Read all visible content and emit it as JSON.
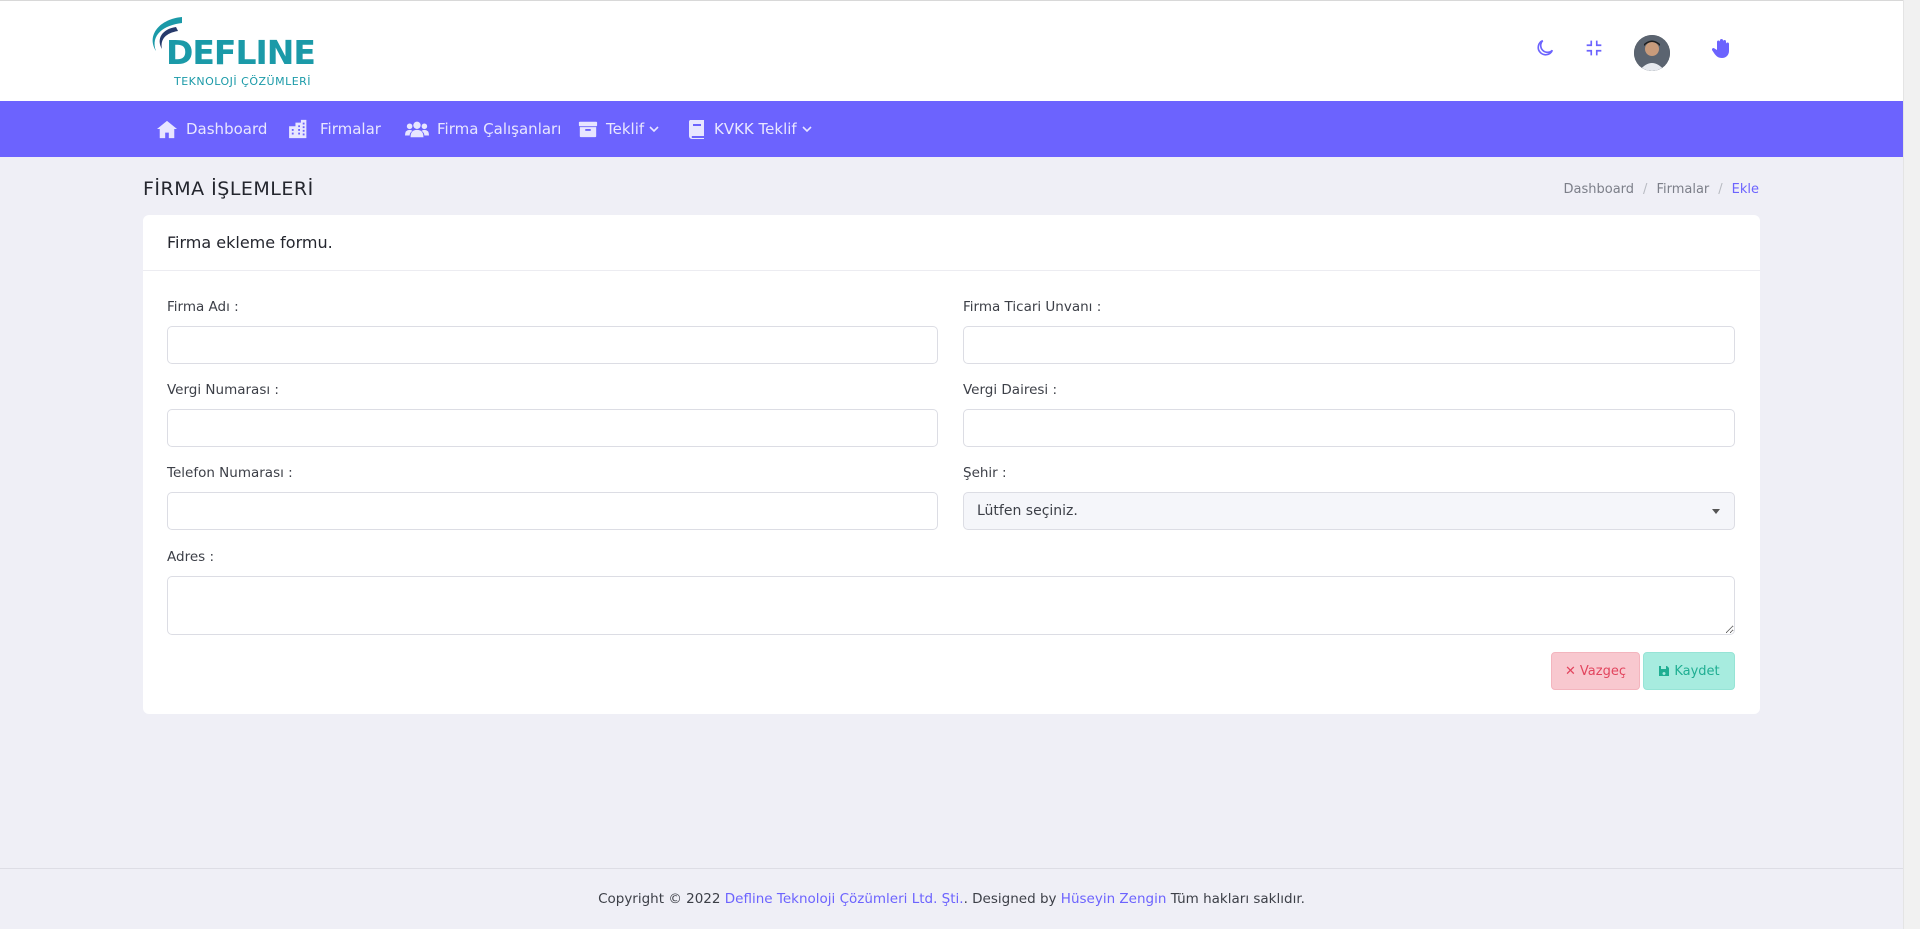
{
  "brand": {
    "logo_text": "DEFLINE",
    "logo_sub": "TEKNOLOJİ ÇÖZÜMLERİ",
    "accent": "#6c63fe",
    "logo_color": "#1b9aa8"
  },
  "topbar": {
    "icons": [
      "moon-icon",
      "compress-icon",
      "avatar",
      "hand-wave-icon"
    ]
  },
  "nav": {
    "items": [
      {
        "label": "Dashboard",
        "icon": "home-icon"
      },
      {
        "label": "Firmalar",
        "icon": "building-icon"
      },
      {
        "label": "Firma Çalışanları",
        "icon": "users-icon"
      },
      {
        "label": "Teklif",
        "icon": "archive-icon",
        "dropdown": true
      },
      {
        "label": "KVKK Teklif",
        "icon": "book-icon",
        "dropdown": true
      }
    ]
  },
  "page": {
    "title": "FİRMA İŞLEMLERİ",
    "breadcrumb": [
      "Dashboard",
      "Firmalar",
      "Ekle"
    ]
  },
  "form": {
    "header": "Firma ekleme formu.",
    "fields": {
      "firma_adi": {
        "label": "Firma Adı :",
        "value": ""
      },
      "ticari_unvan": {
        "label": "Firma Ticari Unvanı :",
        "value": ""
      },
      "vergi_no": {
        "label": "Vergi Numarası :",
        "value": ""
      },
      "vergi_dairesi": {
        "label": "Vergi Dairesi :",
        "value": ""
      },
      "telefon": {
        "label": "Telefon Numarası :",
        "value": ""
      },
      "sehir": {
        "label": "Şehir :",
        "selected": "Lütfen seçiniz."
      },
      "adres": {
        "label": "Adres :",
        "value": ""
      }
    },
    "cancel_label": "Vazgeç",
    "save_label": "Kaydet"
  },
  "footer": {
    "prefix": "Copyright © 2022 ",
    "company": "Defline Teknoloji Çözümleri Ltd. Şti.",
    "middle": ". Designed by ",
    "designer": "Hüseyin Zengin",
    "suffix": " Tüm hakları saklıdır."
  }
}
